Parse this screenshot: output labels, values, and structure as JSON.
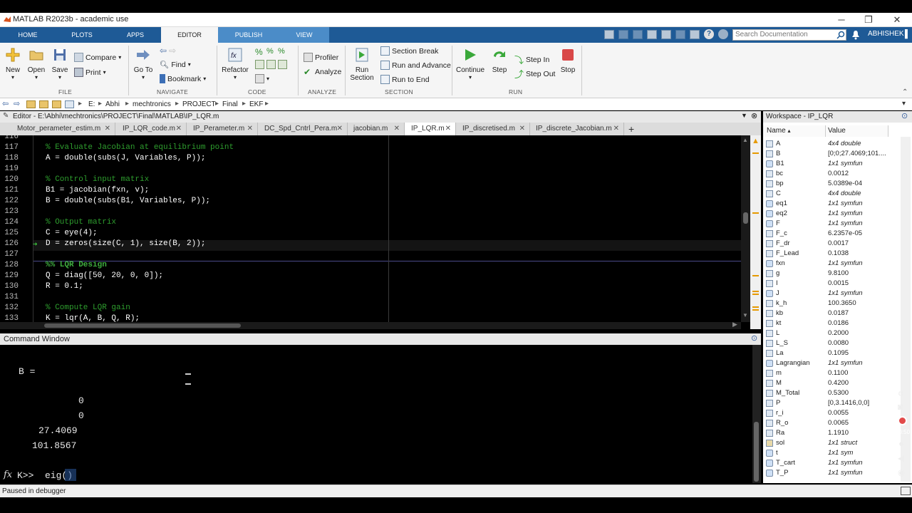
{
  "window": {
    "title": "MATLAB R2023b - academic use"
  },
  "tabs": [
    {
      "label": "HOME"
    },
    {
      "label": "PLOTS"
    },
    {
      "label": "APPS"
    },
    {
      "label": "EDITOR"
    },
    {
      "label": "PUBLISH"
    },
    {
      "label": "VIEW"
    }
  ],
  "search": {
    "placeholder": "Search Documentation"
  },
  "user": {
    "name": "ABHISHEK"
  },
  "ribbon": {
    "new": "New",
    "open": "Open",
    "save": "Save",
    "compare": "Compare",
    "print": "Print",
    "goto": "Go To",
    "find": "Find",
    "bookmark": "Bookmark",
    "refactor": "Refactor",
    "profiler": "Profiler",
    "analyze": "Analyze",
    "run_section": "Run Section",
    "section_break": "Section Break",
    "run_and_advance": "Run and Advance",
    "run_to_end": "Run to End",
    "continue": "Continue",
    "step": "Step",
    "step_in": "Step In",
    "step_out": "Step Out",
    "stop": "Stop",
    "sections": {
      "file": "FILE",
      "navigate": "NAVIGATE",
      "code": "CODE",
      "analyze": "ANALYZE",
      "section": "SECTION",
      "run": "RUN"
    }
  },
  "address": {
    "parts": [
      "E:",
      "Abhi",
      "mechtronics",
      "PROJECT",
      "Final",
      "EKF"
    ]
  },
  "editor": {
    "header": "Editor - E:\\Abhi\\mechtronics\\PROJECT\\Final\\MATLAB\\IP_LQR.m",
    "tabs": [
      "Motor_perameter_estim.m",
      "IP_LQR_code.m",
      "IP_Perameter.m",
      "DC_Spd_Cntrl_Pera.m",
      "jacobian.m",
      "IP_LQR.m",
      "IP_discretised.m",
      "IP_discrete_Jacobian.m"
    ],
    "add_tab": "+",
    "lines": [
      {
        "n": "116",
        "t": "",
        "k": "code"
      },
      {
        "n": "117",
        "t": "% Evaluate Jacobian at equilibrium point",
        "k": "c"
      },
      {
        "n": "118",
        "t": "A = double(subs(J, Variables, P));",
        "k": "code"
      },
      {
        "n": "119",
        "t": "",
        "k": "code"
      },
      {
        "n": "120",
        "t": "% Control input matrix",
        "k": "c"
      },
      {
        "n": "121",
        "t": "B1 = jacobian(fxn, v);",
        "k": "code"
      },
      {
        "n": "122",
        "t": "B = double(subs(B1, Variables, P));",
        "k": "code"
      },
      {
        "n": "123",
        "t": "",
        "k": "code"
      },
      {
        "n": "124",
        "t": "% Output matrix",
        "k": "c"
      },
      {
        "n": "125",
        "t": "C = eye(4);",
        "k": "code"
      },
      {
        "n": "126",
        "t": "D = zeros(size(C, 1), size(B, 2));",
        "k": "code"
      },
      {
        "n": "127",
        "t": "",
        "k": "code"
      },
      {
        "n": "128",
        "t": "%% LQR Design",
        "k": "cb"
      },
      {
        "n": "129",
        "t": "Q = diag([50, 20, 0, 0]);",
        "k": "code"
      },
      {
        "n": "130",
        "t": "R = 0.1;",
        "k": "code"
      },
      {
        "n": "131",
        "t": "",
        "k": "code"
      },
      {
        "n": "132",
        "t": "% Compute LQR gain",
        "k": "c"
      },
      {
        "n": "133",
        "t": "K = lqr(A, B, Q, R);",
        "k": "code"
      }
    ],
    "debug_arrow": "➔"
  },
  "command_window": {
    "title": "Command Window",
    "lines": [
      "B =",
      "0",
      "0",
      "27.4069",
      "101.8567"
    ],
    "prompt": "K>> ",
    "input": "eig()",
    "fx": "fx"
  },
  "status": {
    "text": "Paused in debugger"
  },
  "workspace": {
    "title": "Workspace - IP_LQR",
    "col_name": "Name",
    "col_value": "Value",
    "rows": [
      {
        "name": "A",
        "value": "4x4 double",
        "it": true,
        "type": "matrix"
      },
      {
        "name": "B",
        "value": "[0;0;27.4069;101....",
        "it": false,
        "type": "matrix"
      },
      {
        "name": "B1",
        "value": "1x1 symfun",
        "it": true,
        "type": "sym"
      },
      {
        "name": "bc",
        "value": "0.0012",
        "it": false,
        "type": "matrix"
      },
      {
        "name": "bp",
        "value": "5.0389e-04",
        "it": false,
        "type": "matrix"
      },
      {
        "name": "C",
        "value": "4x4 double",
        "it": true,
        "type": "matrix"
      },
      {
        "name": "eq1",
        "value": "1x1 symfun",
        "it": true,
        "type": "sym"
      },
      {
        "name": "eq2",
        "value": "1x1 symfun",
        "it": true,
        "type": "sym"
      },
      {
        "name": "F",
        "value": "1x1 symfun",
        "it": true,
        "type": "sym"
      },
      {
        "name": "F_c",
        "value": "6.2357e-05",
        "it": false,
        "type": "matrix"
      },
      {
        "name": "F_dr",
        "value": "0.0017",
        "it": false,
        "type": "matrix"
      },
      {
        "name": "F_Lead",
        "value": "0.1038",
        "it": false,
        "type": "matrix"
      },
      {
        "name": "fxn",
        "value": "1x1 symfun",
        "it": true,
        "type": "sym"
      },
      {
        "name": "g",
        "value": "9.8100",
        "it": false,
        "type": "matrix"
      },
      {
        "name": "I",
        "value": "0.0015",
        "it": false,
        "type": "matrix"
      },
      {
        "name": "J",
        "value": "1x1 symfun",
        "it": true,
        "type": "sym"
      },
      {
        "name": "k_h",
        "value": "100.3650",
        "it": false,
        "type": "matrix"
      },
      {
        "name": "kb",
        "value": "0.0187",
        "it": false,
        "type": "matrix"
      },
      {
        "name": "kt",
        "value": "0.0186",
        "it": false,
        "type": "matrix"
      },
      {
        "name": "L",
        "value": "0.2000",
        "it": false,
        "type": "matrix"
      },
      {
        "name": "L_S",
        "value": "0.0080",
        "it": false,
        "type": "matrix"
      },
      {
        "name": "La",
        "value": "0.1095",
        "it": false,
        "type": "matrix"
      },
      {
        "name": "Lagrangian",
        "value": "1x1 symfun",
        "it": true,
        "type": "sym"
      },
      {
        "name": "m",
        "value": "0.1100",
        "it": false,
        "type": "matrix"
      },
      {
        "name": "M",
        "value": "0.4200",
        "it": false,
        "type": "matrix"
      },
      {
        "name": "M_Total",
        "value": "0.5300",
        "it": false,
        "type": "matrix"
      },
      {
        "name": "P",
        "value": "[0,3.1416,0,0]",
        "it": false,
        "type": "matrix"
      },
      {
        "name": "r_i",
        "value": "0.0055",
        "it": false,
        "type": "matrix"
      },
      {
        "name": "R_o",
        "value": "0.0065",
        "it": false,
        "type": "matrix"
      },
      {
        "name": "Ra",
        "value": "1.1910",
        "it": false,
        "type": "matrix"
      },
      {
        "name": "sol",
        "value": "1x1 struct",
        "it": true,
        "type": "struct"
      },
      {
        "name": "t",
        "value": "1x1 sym",
        "it": true,
        "type": "sym"
      },
      {
        "name": "T_cart",
        "value": "1x1 symfun",
        "it": true,
        "type": "sym"
      },
      {
        "name": "T_P",
        "value": "1x1 symfun",
        "it": true,
        "type": "sym"
      }
    ]
  },
  "overlay": {
    "timer": "00:50"
  }
}
